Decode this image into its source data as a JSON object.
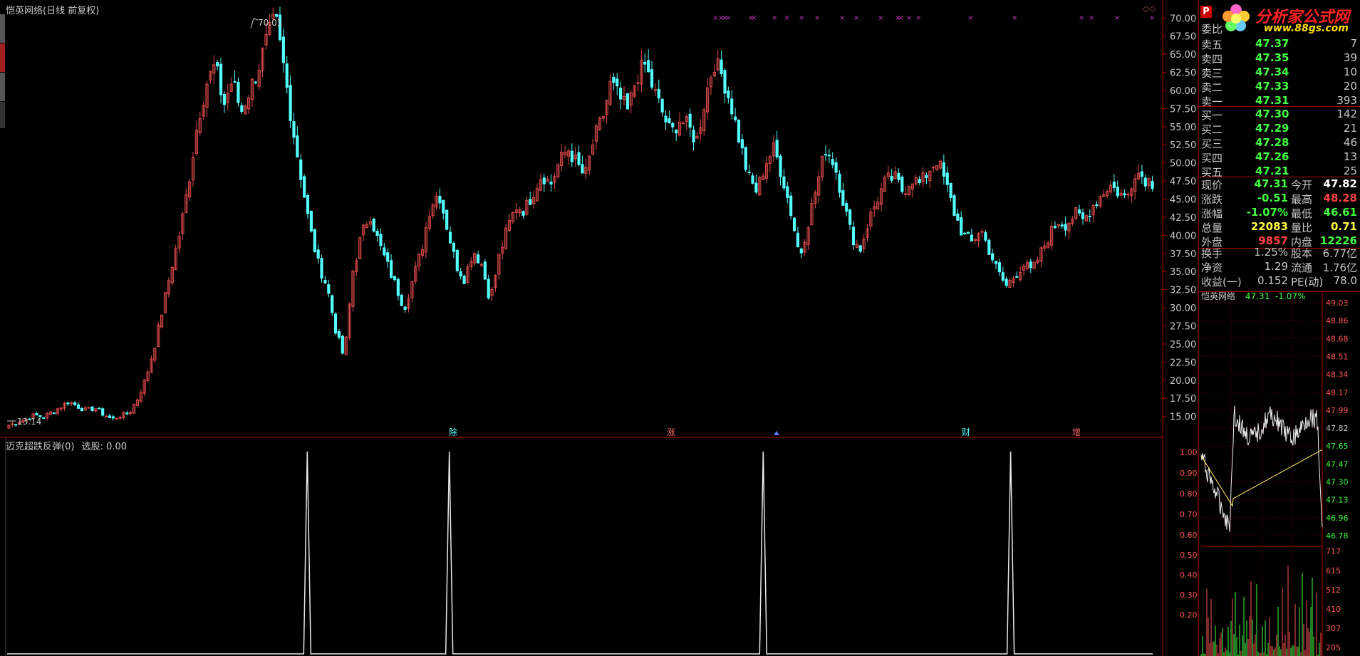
{
  "window": {
    "header": "恺英网络(日线 前复权)",
    "indicator_title": "迈克超跌反弹(0)",
    "indicator_value": "选股: 0.00"
  },
  "colors": {
    "background": "#000000",
    "up_candle": "#e04a4a",
    "down_candle": "#54ffff",
    "grid_line": "#b00000",
    "green_text": "#44ff44",
    "red_text": "#ff4444"
  },
  "logo": {
    "name": "分析家公式网",
    "url": "www.88gs.com"
  },
  "quote_panel": {
    "header_label": "委比",
    "sell_rows": [
      {
        "label": "卖五",
        "price": "47.37",
        "vol": "7"
      },
      {
        "label": "卖四",
        "price": "47.35",
        "vol": "39"
      },
      {
        "label": "卖三",
        "price": "47.34",
        "vol": "10"
      },
      {
        "label": "卖二",
        "price": "47.33",
        "vol": "20"
      },
      {
        "label": "卖一",
        "price": "47.31",
        "vol": "393"
      }
    ],
    "buy_rows": [
      {
        "label": "买一",
        "price": "47.30",
        "vol": "142"
      },
      {
        "label": "买二",
        "price": "47.29",
        "vol": "21"
      },
      {
        "label": "买三",
        "price": "47.28",
        "vol": "46"
      },
      {
        "label": "买四",
        "price": "47.26",
        "vol": "13"
      },
      {
        "label": "买五",
        "price": "47.21",
        "vol": "25"
      }
    ],
    "stats": [
      {
        "l1": "现价",
        "v1": "47.31",
        "l2": "今开",
        "v2": "47.82",
        "c2": "#ffffff"
      },
      {
        "l1": "涨跌",
        "v1": "-0.51",
        "l2": "最高",
        "v2": "48.28",
        "c2": "#ff4444"
      },
      {
        "l1": "涨幅",
        "v1": "-1.07%",
        "l2": "最低",
        "v2": "46.61",
        "c2": "#44ff44"
      },
      {
        "l1": "总量",
        "v1": "22083",
        "l2": "量比",
        "v2": "0.71",
        "c2": "#ffff44",
        "c1": "#ffff44"
      },
      {
        "l1": "外盘",
        "v1": "9857",
        "l2": "内盘",
        "v2": "12226",
        "c1": "#ff4444",
        "c2": "#44ff44"
      }
    ],
    "stats2": [
      {
        "l1": "换手",
        "v1": "1.25%",
        "l2": "股本",
        "v2": "6.77亿"
      },
      {
        "l1": "净资",
        "v1": "1.29",
        "l2": "流通",
        "v2": "1.76亿"
      },
      {
        "l1": "收益(一)",
        "v1": "0.152",
        "l2": "PE(动)",
        "v2": "78.0"
      }
    ]
  },
  "intraday": {
    "title": "恺英网络",
    "price": "47.31",
    "change": "-1.07%",
    "price_ticks": [
      "49.03",
      "48.86",
      "48.68",
      "48.51",
      "48.34",
      "48.17",
      "47.99",
      "47.82",
      "47.65",
      "47.47",
      "47.30",
      "47.13",
      "46.96",
      "46.78"
    ],
    "pct_ticks": [
      "1.00",
      "0.90",
      "0.80",
      "0.70",
      "0.60"
    ],
    "vol_left_ticks": [
      "0.50",
      "0.40",
      "0.30",
      "0.20"
    ],
    "vol_right_ticks": [
      "717",
      "615",
      "512",
      "410",
      "307",
      "205"
    ]
  },
  "chart_data": [
    {
      "type": "candlestick",
      "title": "恺英网络(日线 前复权)",
      "y_ticks": [
        "70.00",
        "67.50",
        "65.00",
        "62.50",
        "60.00",
        "57.50",
        "55.00",
        "52.50",
        "50.00",
        "47.50",
        "45.00",
        "42.50",
        "40.00",
        "37.50",
        "35.00",
        "32.50",
        "30.00",
        "27.50",
        "25.00",
        "22.50",
        "20.00",
        "17.50",
        "15.00"
      ],
      "ylim": [
        13.0,
        71.5
      ],
      "annotations": [
        {
          "label": "70.01",
          "kind": "high"
        },
        {
          "label": "13.14",
          "kind": "low"
        }
      ],
      "event_markers": [
        "除",
        "涨",
        "财",
        "增"
      ],
      "close_path": [
        13.8,
        14.2,
        14.6,
        15.2,
        14.9,
        15.6,
        16.3,
        17.1,
        16.4,
        15.8,
        16.2,
        15.3,
        14.6,
        15.1,
        15.5,
        17.5,
        20.5,
        25.0,
        30.5,
        36.0,
        41.0,
        48.0,
        56.0,
        61.0,
        63.5,
        58.0,
        61.5,
        57.0,
        60.0,
        63.0,
        67.0,
        70.0,
        63.0,
        55.0,
        48.0,
        41.0,
        36.0,
        33.0,
        27.0,
        23.0,
        35.0,
        40.0,
        43.0,
        39.0,
        36.0,
        33.0,
        30.0,
        34.0,
        38.0,
        44.0,
        46.0,
        41.0,
        36.0,
        34.0,
        38.0,
        36.0,
        31.0,
        37.0,
        41.0,
        44.0,
        43.5,
        46.0,
        48.5,
        47.0,
        50.0,
        52.0,
        50.0,
        48.0,
        53.0,
        56.0,
        61.0,
        59.0,
        57.0,
        62.0,
        63.5,
        60.0,
        57.0,
        54.0,
        56.0,
        55.0,
        53.0,
        59.0,
        64.0,
        62.0,
        58.0,
        53.0,
        48.0,
        46.0,
        50.0,
        52.0,
        48.0,
        43.0,
        37.0,
        42.0,
        47.0,
        52.0,
        50.0,
        45.0,
        40.0,
        38.0,
        42.0,
        45.0,
        47.5,
        48.0,
        46.0,
        48.0,
        47.0,
        49.0,
        50.5,
        47.0,
        43.0,
        40.0,
        39.0,
        41.0,
        38.0,
        35.0,
        33.0,
        34.5,
        36.0,
        35.0,
        37.5,
        40.0,
        42.0,
        41.5,
        43.0,
        42.0,
        44.0,
        45.5,
        47.0,
        46.0,
        45.0,
        49.0,
        48.0,
        47.3
      ]
    },
    {
      "type": "line",
      "title": "迈克超跌反弹(0)",
      "series_label": "选股",
      "value": 0.0,
      "spike_positions": [
        0.262,
        0.386,
        0.66,
        0.876
      ]
    }
  ]
}
